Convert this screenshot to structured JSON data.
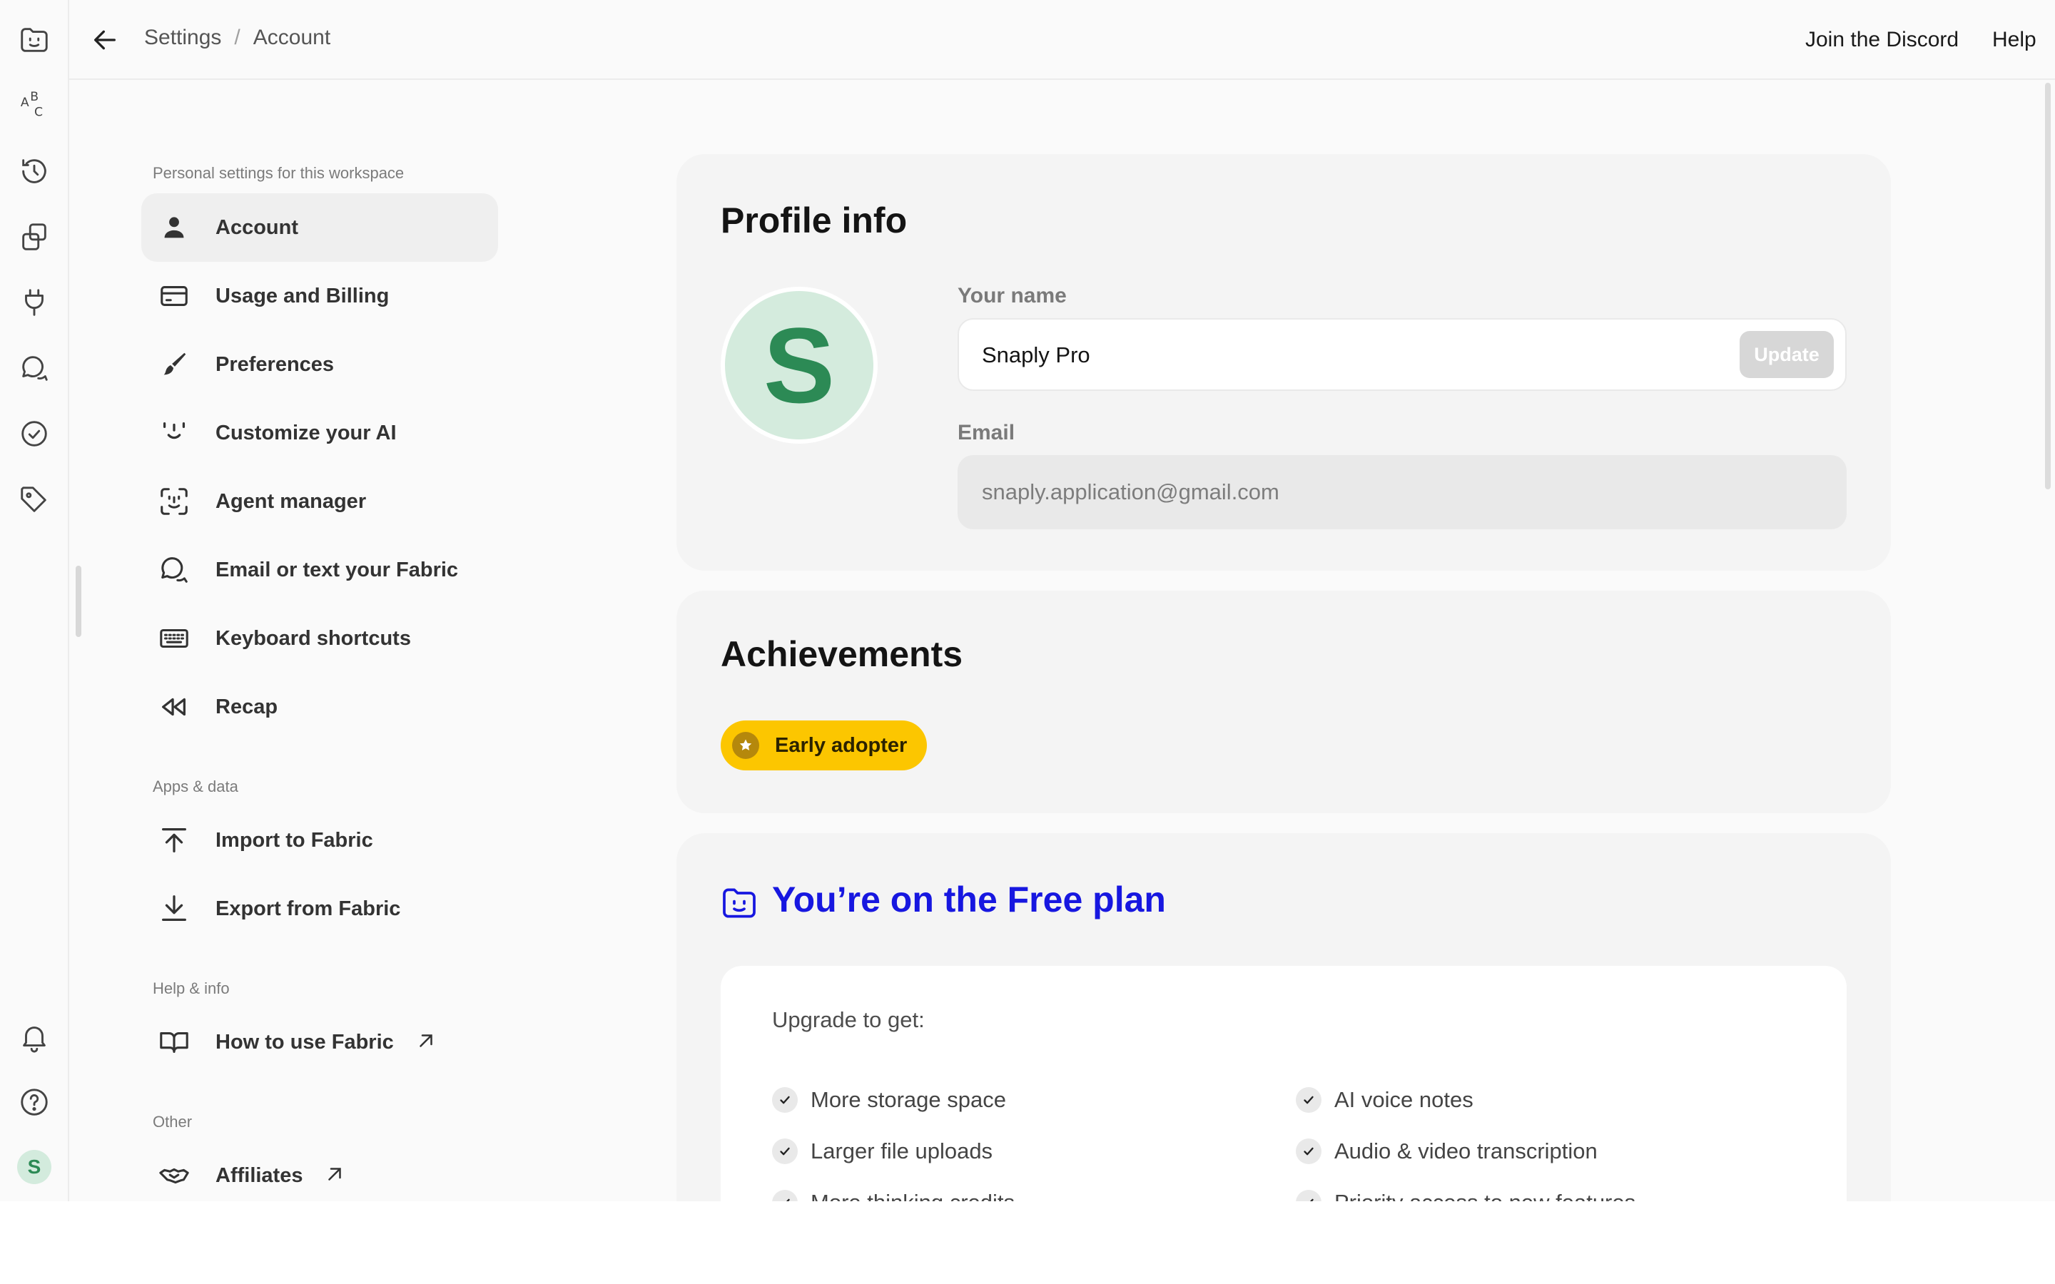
{
  "topbar": {
    "breadcrumb": [
      "Settings",
      "Account"
    ],
    "breadcrumb_separator": "/",
    "join_discord": "Join the Discord",
    "help": "Help"
  },
  "rail": {
    "icons": [
      "fabric-logo-icon",
      "abc-icon",
      "history-icon",
      "copy-icon",
      "plug-icon",
      "chat-icon",
      "check-circle-icon",
      "tag-icon",
      "bell-icon",
      "help-icon"
    ],
    "avatar_letter": "S"
  },
  "nav": {
    "section_personal": "Personal settings for this workspace",
    "section_apps": "Apps & data",
    "section_help": "Help & info",
    "section_other": "Other",
    "items": [
      {
        "label": "Account",
        "icon": "person-icon",
        "active": true
      },
      {
        "label": "Usage and Billing",
        "icon": "credit-card-icon"
      },
      {
        "label": "Preferences",
        "icon": "brush-icon"
      },
      {
        "label": "Customize your AI",
        "icon": "smile-icon"
      },
      {
        "label": "Agent manager",
        "icon": "agent-face-icon"
      },
      {
        "label": "Email or text your Fabric",
        "icon": "chat-bubbles-icon"
      },
      {
        "label": "Keyboard shortcuts",
        "icon": "keyboard-icon"
      },
      {
        "label": "Recap",
        "icon": "rewind-icon"
      }
    ],
    "apps_items": [
      {
        "label": "Import to Fabric",
        "icon": "upload-icon"
      },
      {
        "label": "Export from Fabric",
        "icon": "download-icon"
      }
    ],
    "help_items": [
      {
        "label": "How to use Fabric",
        "icon": "book-icon",
        "external": true
      }
    ],
    "other_items": [
      {
        "label": "Affiliates",
        "icon": "handshake-icon",
        "external": true
      }
    ]
  },
  "profile": {
    "title": "Profile info",
    "avatar_letter": "S",
    "name_label": "Your name",
    "name_value": "Snaply Pro",
    "update_label": "Update",
    "email_label": "Email",
    "email_value": "snaply.application@gmail.com"
  },
  "achievements": {
    "title": "Achievements",
    "badges": [
      {
        "label": "Early adopter",
        "icon": "star-icon"
      }
    ]
  },
  "plan": {
    "title": "You’re on the Free plan",
    "upgrade_heading": "Upgrade to get:",
    "features_left": [
      "More storage space",
      "Larger file uploads",
      "More thinking credits"
    ],
    "features_right": [
      "AI voice notes",
      "Audio & video transcription",
      "Priority access to new features"
    ]
  },
  "colors": {
    "accent_blue": "#1717e0",
    "badge_yellow": "#fcc600",
    "avatar_green": "#2c8a55",
    "avatar_bg": "#d4ebdd"
  }
}
